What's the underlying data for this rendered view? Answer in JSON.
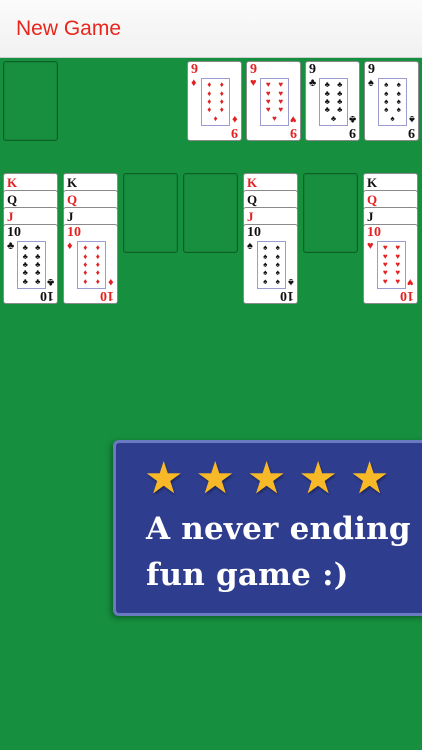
{
  "topbar": {
    "new_game_label": "New Game"
  },
  "foundations": [
    {
      "rank": "9",
      "suit": "♦",
      "color": "red"
    },
    {
      "rank": "9",
      "suit": "♥",
      "color": "red"
    },
    {
      "rank": "9",
      "suit": "♣",
      "color": "black"
    },
    {
      "rank": "9",
      "suit": "♠",
      "color": "black"
    }
  ],
  "tableau": [
    {
      "partials": [
        {
          "rank": "K",
          "color": "red"
        },
        {
          "rank": "Q",
          "color": "black"
        },
        {
          "rank": "J",
          "color": "red"
        }
      ],
      "top": {
        "rank": "10",
        "suit": "♣",
        "color": "black"
      }
    },
    {
      "partials": [
        {
          "rank": "K",
          "color": "black"
        },
        {
          "rank": "Q",
          "color": "red"
        },
        {
          "rank": "J",
          "color": "black"
        }
      ],
      "top": {
        "rank": "10",
        "suit": "♦",
        "color": "red"
      }
    },
    {
      "partials": [],
      "top": null
    },
    {
      "partials": [],
      "top": null
    },
    {
      "partials": [
        {
          "rank": "K",
          "color": "red"
        },
        {
          "rank": "Q",
          "color": "black"
        },
        {
          "rank": "J",
          "color": "red"
        }
      ],
      "top": {
        "rank": "10",
        "suit": "♠",
        "color": "black"
      }
    },
    {
      "partials": [],
      "top": null
    },
    {
      "partials": [
        {
          "rank": "K",
          "color": "black"
        },
        {
          "rank": "Q",
          "color": "red"
        },
        {
          "rank": "J",
          "color": "black"
        }
      ],
      "top": {
        "rank": "10",
        "suit": "♥",
        "color": "red"
      }
    }
  ],
  "promo": {
    "stars": [
      "★",
      "★",
      "★",
      "★",
      "★"
    ],
    "line1": "A never ending",
    "line2": "fun game :)"
  }
}
